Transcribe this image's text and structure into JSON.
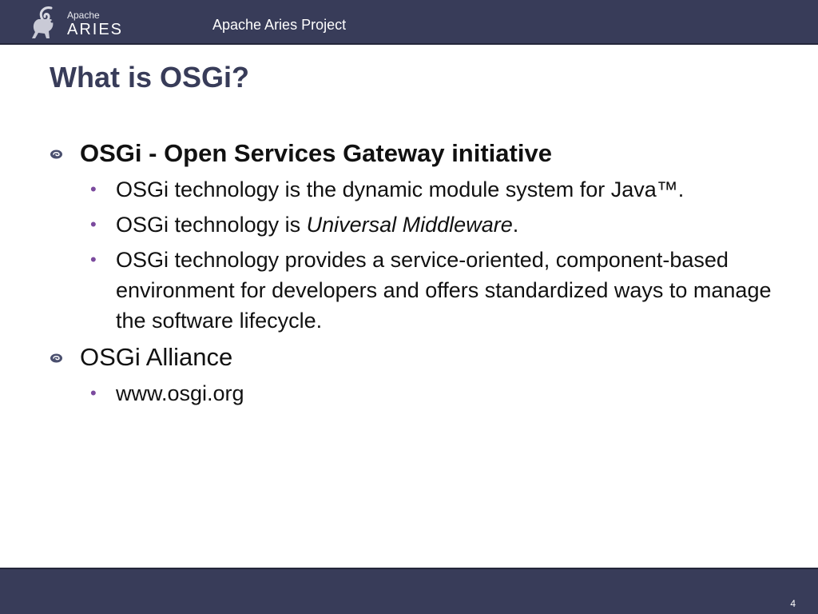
{
  "header": {
    "logo_small": "Apache",
    "logo_big": "ARIES",
    "project": "Apache Aries Project"
  },
  "slide": {
    "title": "What is OSGi?",
    "sections": [
      {
        "heading": "OSGi - Open Services Gateway initiative",
        "items": [
          "OSGi technology is the dynamic module system for Java™.",
          {
            "prefix": "OSGi technology is ",
            "emphasis": "Universal Middleware",
            "suffix": "."
          },
          "OSGi technology provides a service-oriented, component-based environment for developers and offers standardized ways to manage the software lifecycle."
        ]
      },
      {
        "heading": "OSGi Alliance",
        "items": [
          "www.osgi.org"
        ]
      }
    ]
  },
  "footer": {
    "page_number": "4"
  },
  "colors": {
    "bar": "#383c59",
    "title": "#383c59",
    "sub_bullet": "#7b4a9e"
  }
}
